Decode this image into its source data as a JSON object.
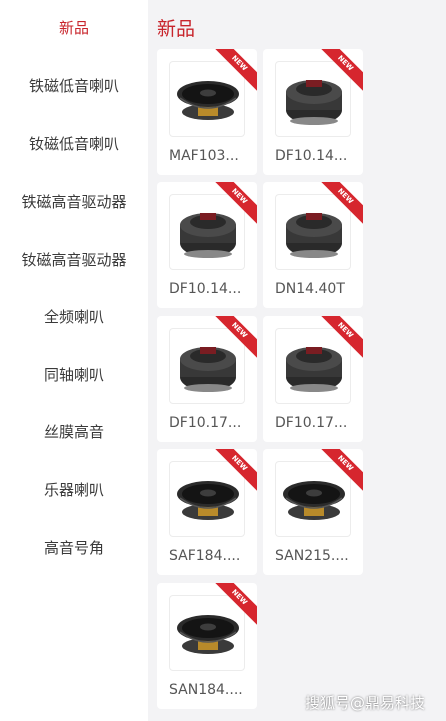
{
  "sidebar": {
    "items": [
      {
        "label": "新品",
        "active": true
      },
      {
        "label": "铁磁低音喇叭"
      },
      {
        "label": "钕磁低音喇叭"
      },
      {
        "label": "铁磁高音驱动器"
      },
      {
        "label": "钕磁高音驱动器"
      },
      {
        "label": "全频喇叭"
      },
      {
        "label": "同轴喇叭"
      },
      {
        "label": "丝膜高音"
      },
      {
        "label": "乐器喇叭"
      },
      {
        "label": "高音号角"
      }
    ]
  },
  "main": {
    "title": "新品",
    "badge_text": "NEW",
    "products": [
      {
        "name": "MAF103...",
        "icon": "woofer-ferrite-icon"
      },
      {
        "name": "DF10.14...",
        "icon": "compression-driver-icon"
      },
      {
        "name": "DF10.14...",
        "icon": "compression-driver-icon"
      },
      {
        "name": "DN14.40T",
        "icon": "compression-driver-icon"
      },
      {
        "name": "DF10.17...",
        "icon": "compression-driver-icon"
      },
      {
        "name": "DF10.17...",
        "icon": "compression-driver-icon"
      },
      {
        "name": "SAF184....",
        "icon": "woofer-icon"
      },
      {
        "name": "SAN215....",
        "icon": "woofer-icon"
      },
      {
        "name": "SAN184....",
        "icon": "woofer-icon"
      }
    ]
  },
  "watermark": "搜狐号@鼎易科技",
  "colors": {
    "accent": "#c8242b",
    "badge": "#d6262e",
    "background": "#f3f3f5"
  }
}
